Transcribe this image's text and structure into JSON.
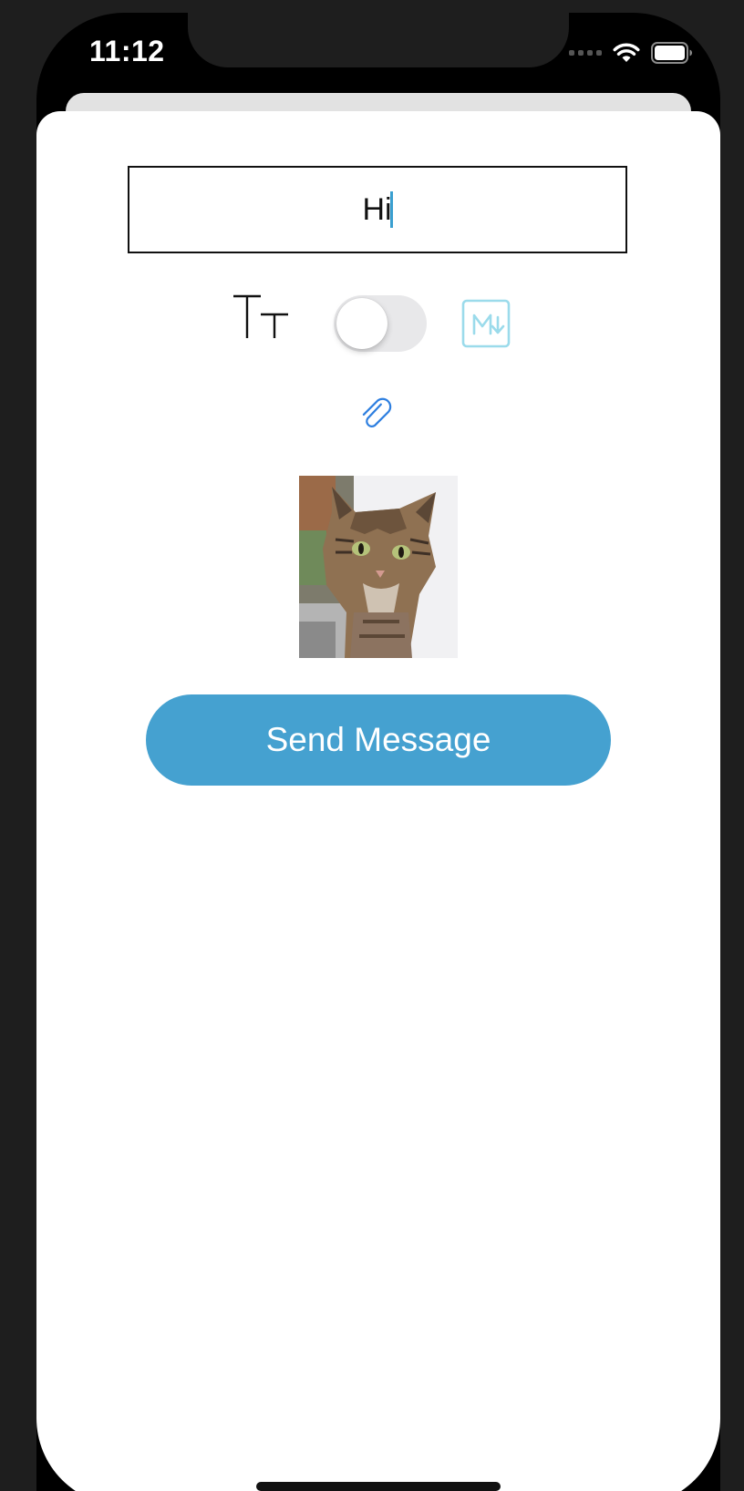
{
  "status_bar": {
    "time": "11:12",
    "icons": [
      "signal-icon",
      "wifi-icon",
      "battery-icon"
    ]
  },
  "composer": {
    "message_value": "Hi",
    "caret_color": "#3a9fd0",
    "text_size_icon": "text-size-icon",
    "markdown_toggle_on": false,
    "markdown_icon": "markdown-icon",
    "markdown_icon_color": "#9bdbeb",
    "attachment_icon": "paperclip-icon",
    "attachment_icon_color": "#2e7fe0",
    "attached_image": "cat-photo",
    "send_label": "Send Message",
    "send_color": "#45a1d0"
  }
}
